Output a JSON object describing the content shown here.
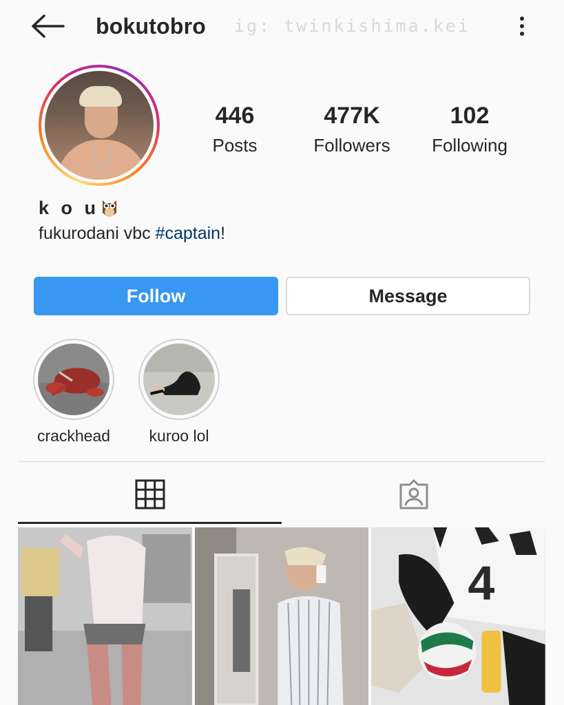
{
  "header": {
    "username": "bokutobro",
    "watermark": "ig: twinkishima.kei",
    "back_icon": "arrow-left-icon",
    "more_icon": "more-vertical-icon"
  },
  "profile": {
    "display_name": "k o u",
    "name_emoji_icon": "owl-icon",
    "bio_text": "fukurodani vbc ",
    "bio_hashtag": "#captain",
    "bio_suffix": "!",
    "hashtag_color": "#003569"
  },
  "stats": [
    {
      "value": "446",
      "label": "Posts"
    },
    {
      "value": "477K",
      "label": "Followers"
    },
    {
      "value": "102",
      "label": "Following"
    }
  ],
  "actions": {
    "follow_label": "Follow",
    "message_label": "Message",
    "follow_color": "#3897f0"
  },
  "highlights": [
    {
      "label": "crackhead"
    },
    {
      "label": "kuroo lol"
    }
  ],
  "tabs": [
    {
      "icon": "grid-icon",
      "active": true
    },
    {
      "icon": "tagged-person-icon",
      "active": false
    }
  ],
  "posts": [
    {
      "name": "gym-selfie-post"
    },
    {
      "name": "mirror-selfie-post"
    },
    {
      "name": "volleyball-jersey-post"
    }
  ]
}
